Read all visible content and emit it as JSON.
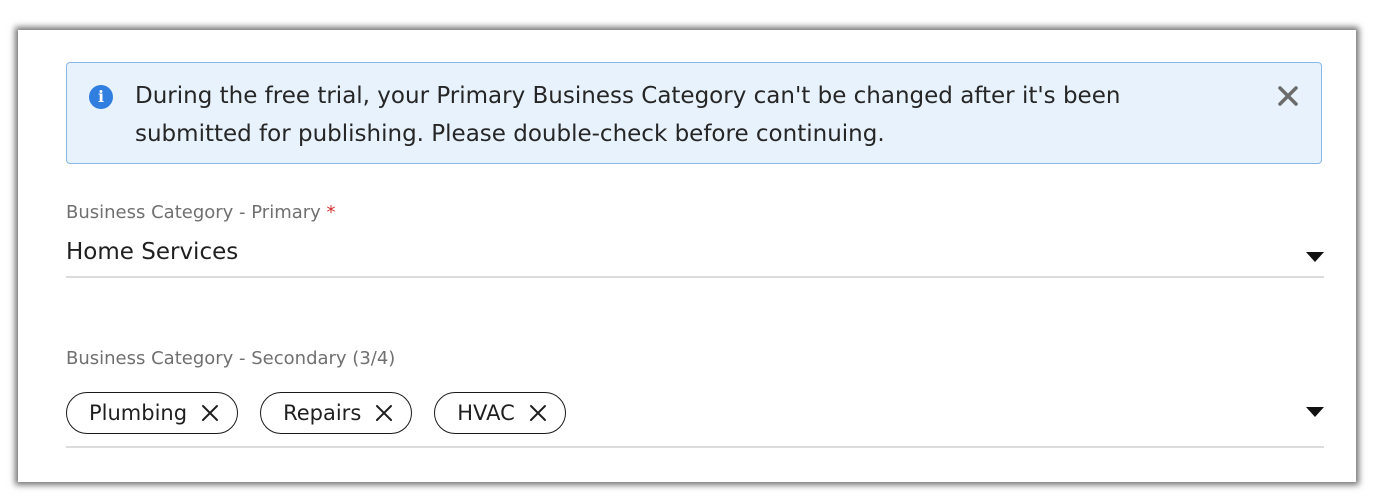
{
  "banner": {
    "icon": "info-icon",
    "line1": "During the free trial, your Primary Business Category can't be changed after it's been",
    "line2": "submitted for publishing. Please double-check before continuing.",
    "close_icon": "close-icon",
    "background": "#e8f2fd",
    "border": "#8ab8e6"
  },
  "primary_category": {
    "label": "Business Category - Primary",
    "required_marker": "*",
    "value": "Home Services",
    "dropdown_icon": "caret-down-icon"
  },
  "secondary_category": {
    "label": "Business Category - Secondary (3/4)",
    "chips": [
      {
        "label": "Plumbing",
        "remove_icon": "close-icon"
      },
      {
        "label": "Repairs",
        "remove_icon": "close-icon"
      },
      {
        "label": "HVAC",
        "remove_icon": "close-icon"
      }
    ],
    "dropdown_icon": "caret-down-icon"
  },
  "colors": {
    "accent": "#2f7ee0",
    "required": "#d32f2f"
  }
}
